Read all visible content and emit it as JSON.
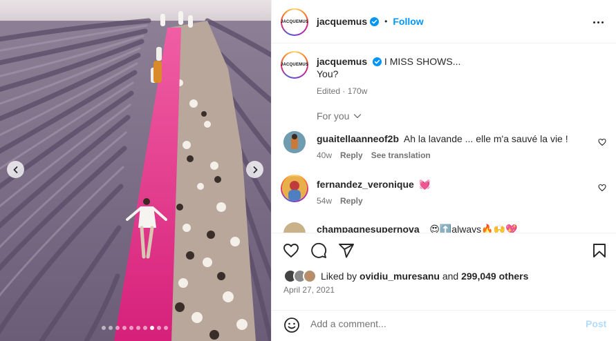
{
  "media": {
    "alt_description": "",
    "slide_count": 10,
    "active_slide": 7
  },
  "header": {
    "username": "jacquemus",
    "avatar_text": "JACQUEMUS",
    "follow_label": "Follow",
    "separator": "•"
  },
  "caption": {
    "username": "jacquemus",
    "text_line1": "I MISS SHOWS...",
    "text_line2": "You?",
    "meta": "Edited · 170w"
  },
  "filter": {
    "label": "For you"
  },
  "comments": [
    {
      "username": "guaitellaanneof2b",
      "text": "Ah la lavande ... elle m'a sauvé la vie !",
      "age": "40w",
      "reply": "Reply",
      "translate": "See translation"
    },
    {
      "username": "fernandez_veronique",
      "text": "💓",
      "age": "54w",
      "reply": "Reply"
    },
    {
      "username": "champagnesupernova_",
      "text": "😍⬆️always🔥🙌💖"
    }
  ],
  "likes": {
    "prefix": "Liked by",
    "user": "ovidiu_muresanu",
    "middle": "and",
    "count": "299,049 others"
  },
  "date": "April 27, 2021",
  "add_comment": {
    "placeholder": "Add a comment...",
    "post_label": "Post"
  },
  "colors": {
    "accent": "#0095f6",
    "runway": "#e0287f",
    "lavender": "#7a6a8a"
  }
}
